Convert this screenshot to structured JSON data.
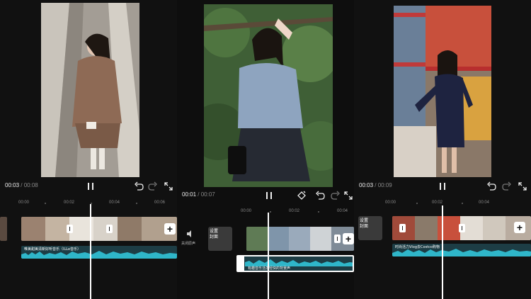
{
  "panels": [
    {
      "time": {
        "current": "00:03",
        "total": "/ 00:08"
      },
      "ruler": [
        "00:00",
        "00:02",
        "00:04",
        "00:06"
      ],
      "audio_label": "唯美甜美清新好听音乐（ILLe音乐）"
    },
    {
      "time": {
        "current": "00:01",
        "total": "/ 00:07"
      },
      "ruler": [
        "00:00",
        "00:02",
        "00:04"
      ],
      "mute_label": "关闭原声",
      "cover_label": "设置\n封面",
      "audio_label": "有趣音乐活泼轻快的背景声"
    },
    {
      "time": {
        "current": "00:03",
        "total": "/ 00:09"
      },
      "ruler": [
        "00:00",
        "00:02",
        "00:04"
      ],
      "cover_label": "设置\n封面",
      "audio_label": "时尚活力Vlog去Costco购物"
    }
  ],
  "icons": [
    "pause-icon",
    "undo-icon",
    "redo-icon",
    "fullscreen-icon",
    "keyframe-icon",
    "speaker-icon",
    "add-clip-icon",
    "transition-icon"
  ],
  "colors": {
    "accent_audio": "#2fb6c9",
    "audio_bg": "#1d3d45",
    "panel_bg": "#111111"
  }
}
